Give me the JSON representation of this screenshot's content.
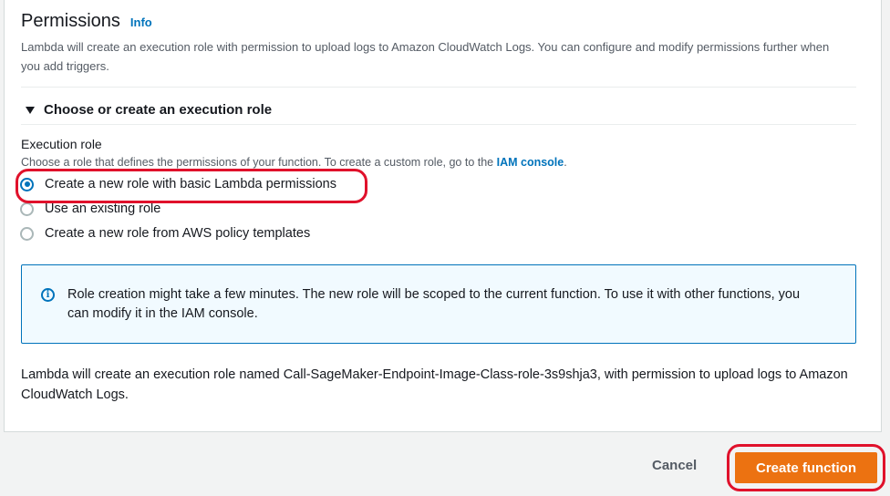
{
  "permissions": {
    "title": "Permissions",
    "info_label": "Info",
    "description": "Lambda will create an execution role with permission to upload logs to Amazon CloudWatch Logs. You can configure and modify permissions further when you add triggers."
  },
  "expander": {
    "label": "Choose or create an execution role"
  },
  "execution_role": {
    "label": "Execution role",
    "description_prefix": "Choose a role that defines the permissions of your function. To create a custom role, go to the",
    "iam_link": "IAM console",
    "description_suffix": ".",
    "options": [
      {
        "label": "Create a new role with basic Lambda permissions",
        "selected": true
      },
      {
        "label": "Use an existing role",
        "selected": false
      },
      {
        "label": "Create a new role from AWS policy templates",
        "selected": false
      }
    ]
  },
  "alert": {
    "icon": "info-icon",
    "text": "Role creation might take a few minutes. The new role will be scoped to the current function. To use it with other functions, you can modify it in the IAM console."
  },
  "bottom_note": "Lambda will create an execution role named Call-SageMaker-Endpoint-Image-Class-role-3s9shja3, with permission to upload logs to Amazon CloudWatch Logs.",
  "footer": {
    "cancel_label": "Cancel",
    "create_label": "Create function"
  },
  "colors": {
    "primary_button": "#ec7211",
    "link": "#0073bb",
    "annotation": "#e0112b"
  }
}
